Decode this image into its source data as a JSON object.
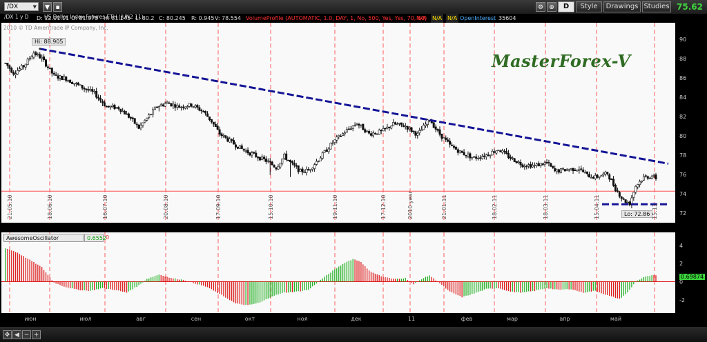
{
  "toolbar": {
    "symbol": "/DX",
    "timeframe": "/DX 1 y D",
    "description": "US Dollar Index Futures,ETH (JUN2 11)",
    "quote": {
      "D": "D: 12.01.11",
      "O": "O: 81.075",
      "H": "H: 81.145",
      "L": "L: 80.2",
      "C": "C: 80.245",
      "R": "R: 0.945",
      "V": "V: 78.554"
    },
    "volume_profile": "VolumeProfile (AUTOMATIC, 1.0, DAY, 1, No, 500, Yes, Yes, 70, 60)",
    "na1": "N/A",
    "na2": "N/A",
    "open_interest_label": "OpenInterest",
    "open_interest_value": "35604",
    "d_button": "D",
    "style": "Style",
    "drawings": "Drawings",
    "studies": "Studies",
    "last_price": "75.62"
  },
  "copyright": "2010 © TD Ameritrade IP Company, Inc.",
  "watermark": "MasterForex-V",
  "chart_data": [
    {
      "type": "candlestick",
      "y_ticks": [
        72,
        74,
        76,
        78,
        80,
        82,
        84,
        86,
        88,
        90
      ],
      "ylim": [
        71.2,
        91.2
      ],
      "vertical_date_labels": [
        "21.05.10",
        "18.06.10",
        "16.07.10",
        "20.08.10",
        "17.09.10",
        "15.10.10",
        "19.11.10",
        "17.12.10",
        "2010 year",
        "21.01.11",
        "18.02.11",
        "18.03.11",
        "15.04.11",
        "15.11"
      ],
      "high_label": "Hi: 88.905",
      "low_label": "Lo: 72.86",
      "horizontal_line": 74.25,
      "trendline": {
        "from": 89.0,
        "to": 77.1
      },
      "support_line": 72.9,
      "anchors": [
        [
          0,
          87.5
        ],
        [
          4,
          86.5
        ],
        [
          9,
          87.2
        ],
        [
          14,
          88.6
        ],
        [
          18,
          88.0
        ],
        [
          24,
          86.2
        ],
        [
          30,
          85.9
        ],
        [
          38,
          85.0
        ],
        [
          44,
          84.4
        ],
        [
          50,
          83.0
        ],
        [
          56,
          82.9
        ],
        [
          62,
          81.8
        ],
        [
          66,
          80.8
        ],
        [
          70,
          81.8
        ],
        [
          75,
          83.0
        ],
        [
          80,
          83.4
        ],
        [
          86,
          83.0
        ],
        [
          92,
          83.2
        ],
        [
          98,
          82.5
        ],
        [
          102,
          81.5
        ],
        [
          106,
          80.2
        ],
        [
          112,
          79.3
        ],
        [
          118,
          78.5
        ],
        [
          124,
          77.9
        ],
        [
          130,
          77.3
        ],
        [
          134,
          76.7
        ],
        [
          138,
          77.9
        ],
        [
          142,
          77.0
        ],
        [
          146,
          76.3
        ],
        [
          150,
          76.4
        ],
        [
          156,
          77.8
        ],
        [
          162,
          79.3
        ],
        [
          168,
          80.4
        ],
        [
          174,
          81.3
        ],
        [
          180,
          80.2
        ],
        [
          186,
          80.4
        ],
        [
          192,
          81.2
        ],
        [
          198,
          81.0
        ],
        [
          204,
          80.1
        ],
        [
          210,
          81.7
        ],
        [
          214,
          80.4
        ],
        [
          220,
          79.0
        ],
        [
          226,
          78.2
        ],
        [
          232,
          77.7
        ],
        [
          238,
          78.0
        ],
        [
          244,
          78.6
        ],
        [
          250,
          77.7
        ],
        [
          256,
          77.0
        ],
        [
          262,
          76.9
        ],
        [
          268,
          77.2
        ],
        [
          272,
          76.3
        ],
        [
          278,
          76.5
        ],
        [
          284,
          76.6
        ],
        [
          288,
          75.9
        ],
        [
          292,
          75.7
        ],
        [
          298,
          76.1
        ],
        [
          302,
          74.5
        ],
        [
          306,
          73.3
        ],
        [
          309,
          73.0
        ],
        [
          312,
          74.8
        ],
        [
          316,
          75.7
        ],
        [
          320,
          75.8
        ],
        [
          322,
          75.6
        ]
      ]
    },
    {
      "type": "bar",
      "name": "AwesomeOscillator",
      "value_label": "0.6552",
      "zero_label": "0",
      "current_value_label": "0.69874",
      "y_ticks": [
        -2,
        0,
        2,
        4
      ],
      "ylim": [
        -3.3,
        4.6
      ],
      "anchors": [
        [
          0,
          3.7
        ],
        [
          6,
          3.2
        ],
        [
          12,
          2.4
        ],
        [
          18,
          1.6
        ],
        [
          24,
          -0.1
        ],
        [
          30,
          -0.6
        ],
        [
          36,
          -0.9
        ],
        [
          42,
          -1.0
        ],
        [
          48,
          -0.7
        ],
        [
          54,
          -0.9
        ],
        [
          60,
          -1.2
        ],
        [
          66,
          -0.4
        ],
        [
          70,
          0.3
        ],
        [
          76,
          0.8
        ],
        [
          82,
          0.4
        ],
        [
          88,
          0.2
        ],
        [
          94,
          -0.2
        ],
        [
          100,
          -0.6
        ],
        [
          108,
          -1.6
        ],
        [
          114,
          -2.4
        ],
        [
          120,
          -2.6
        ],
        [
          126,
          -2.3
        ],
        [
          132,
          -1.6
        ],
        [
          138,
          -1.2
        ],
        [
          144,
          -1.1
        ],
        [
          150,
          -0.9
        ],
        [
          156,
          0.2
        ],
        [
          162,
          1.2
        ],
        [
          168,
          2.1
        ],
        [
          172,
          2.5
        ],
        [
          176,
          2.2
        ],
        [
          180,
          1.2
        ],
        [
          186,
          0.6
        ],
        [
          192,
          0.3
        ],
        [
          198,
          0.4
        ],
        [
          202,
          -0.3
        ],
        [
          206,
          0.3
        ],
        [
          210,
          0.7
        ],
        [
          214,
          0.0
        ],
        [
          220,
          -1.1
        ],
        [
          226,
          -1.7
        ],
        [
          232,
          -1.3
        ],
        [
          238,
          -0.8
        ],
        [
          244,
          -0.7
        ],
        [
          250,
          -1.1
        ],
        [
          256,
          -1.2
        ],
        [
          262,
          -1.0
        ],
        [
          268,
          -0.7
        ],
        [
          274,
          -0.9
        ],
        [
          280,
          -0.8
        ],
        [
          286,
          -1.2
        ],
        [
          292,
          -1.0
        ],
        [
          298,
          -1.5
        ],
        [
          304,
          -1.9
        ],
        [
          308,
          -1.2
        ],
        [
          312,
          0.0
        ],
        [
          316,
          0.5
        ],
        [
          320,
          0.7
        ],
        [
          322,
          0.7
        ]
      ]
    }
  ],
  "month_labels": [
    "июн",
    "июл",
    "авг",
    "сен",
    "окт",
    "ноя",
    "дек",
    "11",
    "фев",
    "мар",
    "апр",
    "май"
  ],
  "colors": {
    "up": "#24b024",
    "down": "#dd1c1c",
    "trend": "#141496",
    "grid": "#ff5a5a"
  }
}
